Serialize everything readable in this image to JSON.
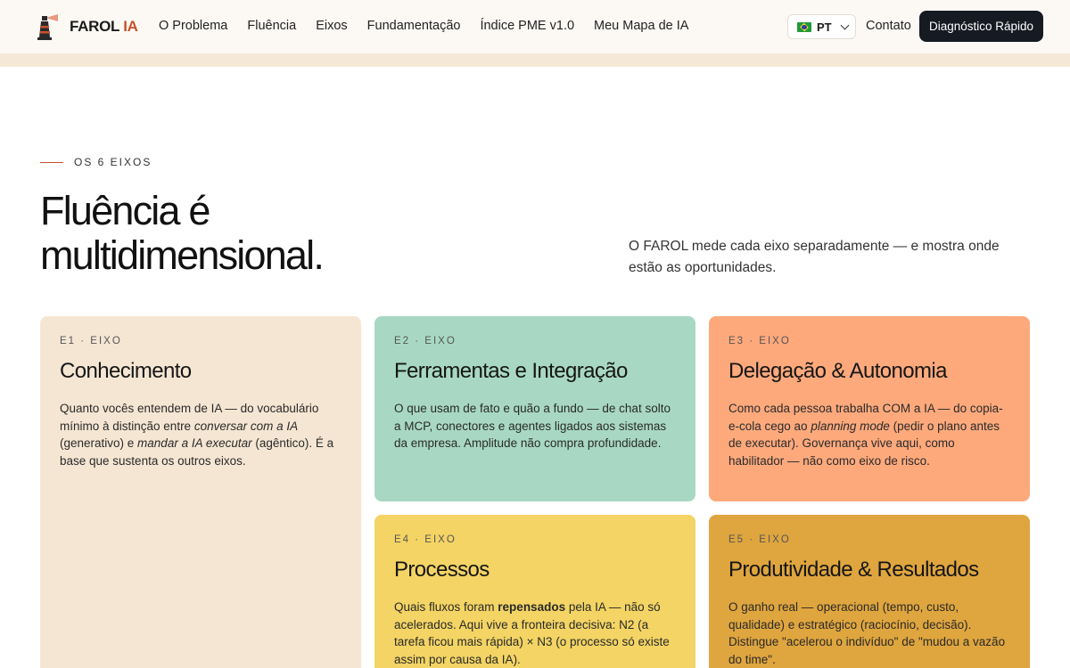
{
  "brand": {
    "name": "FAROL",
    "accent": "IA"
  },
  "nav": [
    "O Problema",
    "Fluência",
    "Eixos",
    "Fundamentação",
    "Índice PME v1.0",
    "Meu Mapa de IA"
  ],
  "language": {
    "code": "PT"
  },
  "contact_label": "Contato",
  "cta_label": "Diagnóstico Rápido",
  "section": {
    "eyebrow": "OS 6 EIXOS",
    "headline_line1": "Fluência é",
    "headline_line2": "multidimensional.",
    "lede": "O FAROL mede cada eixo separadamente — e mostra onde estão as oportunidades."
  },
  "cards": [
    {
      "tag": "E1 · EIXO",
      "title": "Conhecimento",
      "t1": "Quanto vocês entendem de IA — do vocabulário mínimo à distinção entre ",
      "e1": "conversar com a IA",
      "t2": " (generativo) e ",
      "e2": "mandar a IA executar",
      "t3": " (agêntico). É a base que sustenta os outros eixos."
    },
    {
      "tag": "E2 · EIXO",
      "title": "Ferramentas e Integração",
      "t1": "O que usam de fato e quão a fundo — de chat solto a MCP, conectores e agentes ligados aos sistemas da empresa. Amplitude não compra profundidade."
    },
    {
      "tag": "E3 · EIXO",
      "title": "Delegação & Autonomia",
      "t1": "Como cada pessoa trabalha COM a IA — do copia-e-cola cego ao ",
      "e1": "planning mode",
      "t2": " (pedir o plano antes de executar). Governança vive aqui, como habilitador — não como eixo de risco."
    },
    {
      "tag": "E4 · EIXO",
      "title": "Processos",
      "t1": "Quais fluxos foram ",
      "b1": "repensados",
      "t2": " pela IA — não só acelerados. Aqui vive a fronteira decisiva: N2 (a tarefa ficou mais rápida) × N3 (o processo só existe assim por causa da IA)."
    },
    {
      "tag": "E5 · EIXO",
      "title": "Produtividade & Resultados",
      "t1": "O ganho real — operacional (tempo, custo, qualidade) e estratégico (raciocínio, decisão). Distingue \"acelerou o indivíduo\" de \"mudou a vazão do time\"."
    }
  ],
  "colors": {
    "accent": "#c9502a",
    "card_e1": "#f5e6d3",
    "card_e2": "#a8d8c3",
    "card_e3": "#fda97c",
    "card_e4": "#f3d464",
    "card_e5": "#dfa53e",
    "cta_bg": "#161a22"
  },
  "icons": {
    "logo": "lighthouse-icon",
    "language_flag": "brazil-flag-icon",
    "language_chevron": "chevron-down-icon"
  }
}
